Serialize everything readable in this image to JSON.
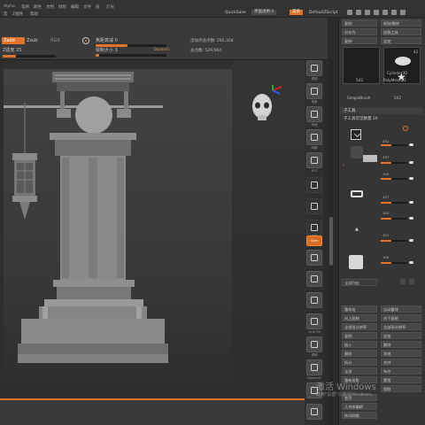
{
  "menubar": {
    "items": [
      "Alpha",
      "笔刷",
      "颜色",
      "文档",
      "绘制",
      "编辑",
      "文件",
      "层",
      "灯光"
    ],
    "extra_items": [
      "宏",
      "Z插件",
      "帮助"
    ],
    "quicksave": "QuickSave",
    "window_label": "界面透明 0",
    "menus_button": "菜单",
    "script_label": "DefaultZScript"
  },
  "toolbar": {
    "zadd": "Zadd",
    "zsub": "Zsub",
    "rgb": "RGB",
    "z_intensity_label": "Z强度 25",
    "z_intensity_value": 0.25,
    "focal_label": "焦距衰减 0",
    "focal_value": 0.45,
    "draw_size_label": "绘制大小 3",
    "draw_size_value": 0.05,
    "dynamic": "Dynamic",
    "active_points": "活动点总点数: 295,304",
    "total_points": "总点数: 529,664"
  },
  "shelf": {
    "items": [
      {
        "label": "透视"
      },
      {
        "label": "地面"
      },
      {
        "label": "本地"
      },
      {
        "label": "网格"
      },
      {
        "label": "XYZ"
      },
      {
        "label": ""
      },
      {
        "label": ""
      },
      {
        "label": "调谐"
      },
      {
        "label": "Sym"
      },
      {
        "label": "Line Fill"
      },
      {
        "label": "透明"
      },
      {
        "label": "Dynamic"
      }
    ],
    "active_index": 8
  },
  "rpanel": {
    "top_buttons": [
      [
        "复制",
        "粘贴/删除"
      ],
      [
        "另存为",
        "加载工具"
      ],
      [
        "复制",
        "追加"
      ]
    ],
    "tools": [
      {
        "name": "Cylinder3D",
        "count": "42"
      },
      {
        "name": "PolyMesh3D",
        "count": ""
      },
      {
        "name": "SimpleBrush",
        "count": "542"
      },
      {
        "name": "",
        "count": "542"
      }
    ],
    "subtool_header": "子工具",
    "subtool_count": "子工具可见数量 19",
    "subtools": [
      {
        "value": "432"
      },
      {
        "value": "297"
      },
      {
        "value": "100"
      },
      {
        "value": "137"
      },
      {
        "value": "102"
      },
      {
        "value": "101"
      },
      {
        "value": "100"
      }
    ],
    "list_all": "全部列出",
    "bottom_buttons": [
      [
        "重命名",
        "自动重排"
      ],
      [
        "向上复制",
        "向下复制"
      ],
      [
        "全部低分辨率",
        "全部高分辨率"
      ],
      [
        "复制",
        "追加"
      ],
      [
        "插入",
        "删除"
      ],
      [
        "删除",
        "其他"
      ],
      [
        "拆分",
        "合并"
      ],
      [
        "全部",
        "布尔"
      ],
      [
        "重新投影",
        "蒙版"
      ],
      [
        "",
        "提取"
      ]
    ],
    "footer_buttons": [
      "变形",
      "几何体编辑",
      "阵列网格"
    ]
  },
  "watermark": {
    "title": "激活 Windows",
    "subtitle": "转到\"设置\"以激活Windows。"
  },
  "colors": {
    "accent": "#e0742a",
    "panel": "#353535",
    "viewport": "#3d3d3d"
  }
}
